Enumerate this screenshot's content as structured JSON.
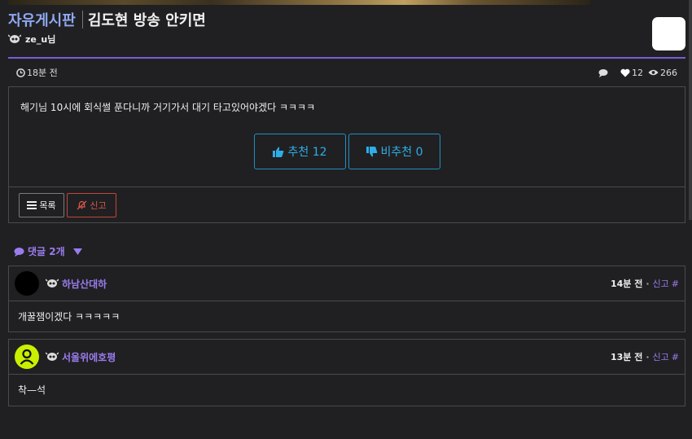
{
  "board": {
    "name": "자유게시판"
  },
  "post": {
    "title": "김도현 방송 안키면",
    "author": "ze_u님",
    "time": "18분 전",
    "comment_count": "2",
    "likes": "12",
    "views": "266",
    "body": "해기님 10시에 회식썰 푼다니까 거기가서 대기 타고있어야겠다 ㅋㅋㅋㅋ",
    "upvote_label": "추천 12",
    "downvote_label": "비추천 0",
    "list_label": "목록",
    "report_label": "신고"
  },
  "comments_section": {
    "label": "댓글 2개",
    "items": [
      {
        "author": "하남산대하",
        "time": "14분 전",
        "report": "신고",
        "hash": "#",
        "body": "개꿀잼이겠다 ㅋㅋㅋㅋㅋ"
      },
      {
        "author": "서울위에호평",
        "time": "13분 전",
        "report": "신고",
        "hash": "#",
        "body": "착—석"
      }
    ]
  },
  "colors": {
    "accent": "#7b5cd6",
    "board": "#8fa8f0",
    "vote": "#2eaee8",
    "report": "#e0574c"
  },
  "icons": [
    "level-icon",
    "clock-icon",
    "comment-icon",
    "heart-icon",
    "eye-icon",
    "thumbs-up-icon",
    "thumbs-down-icon",
    "list-icon",
    "bell-slash-icon",
    "caret-down-icon",
    "user-icon"
  ]
}
